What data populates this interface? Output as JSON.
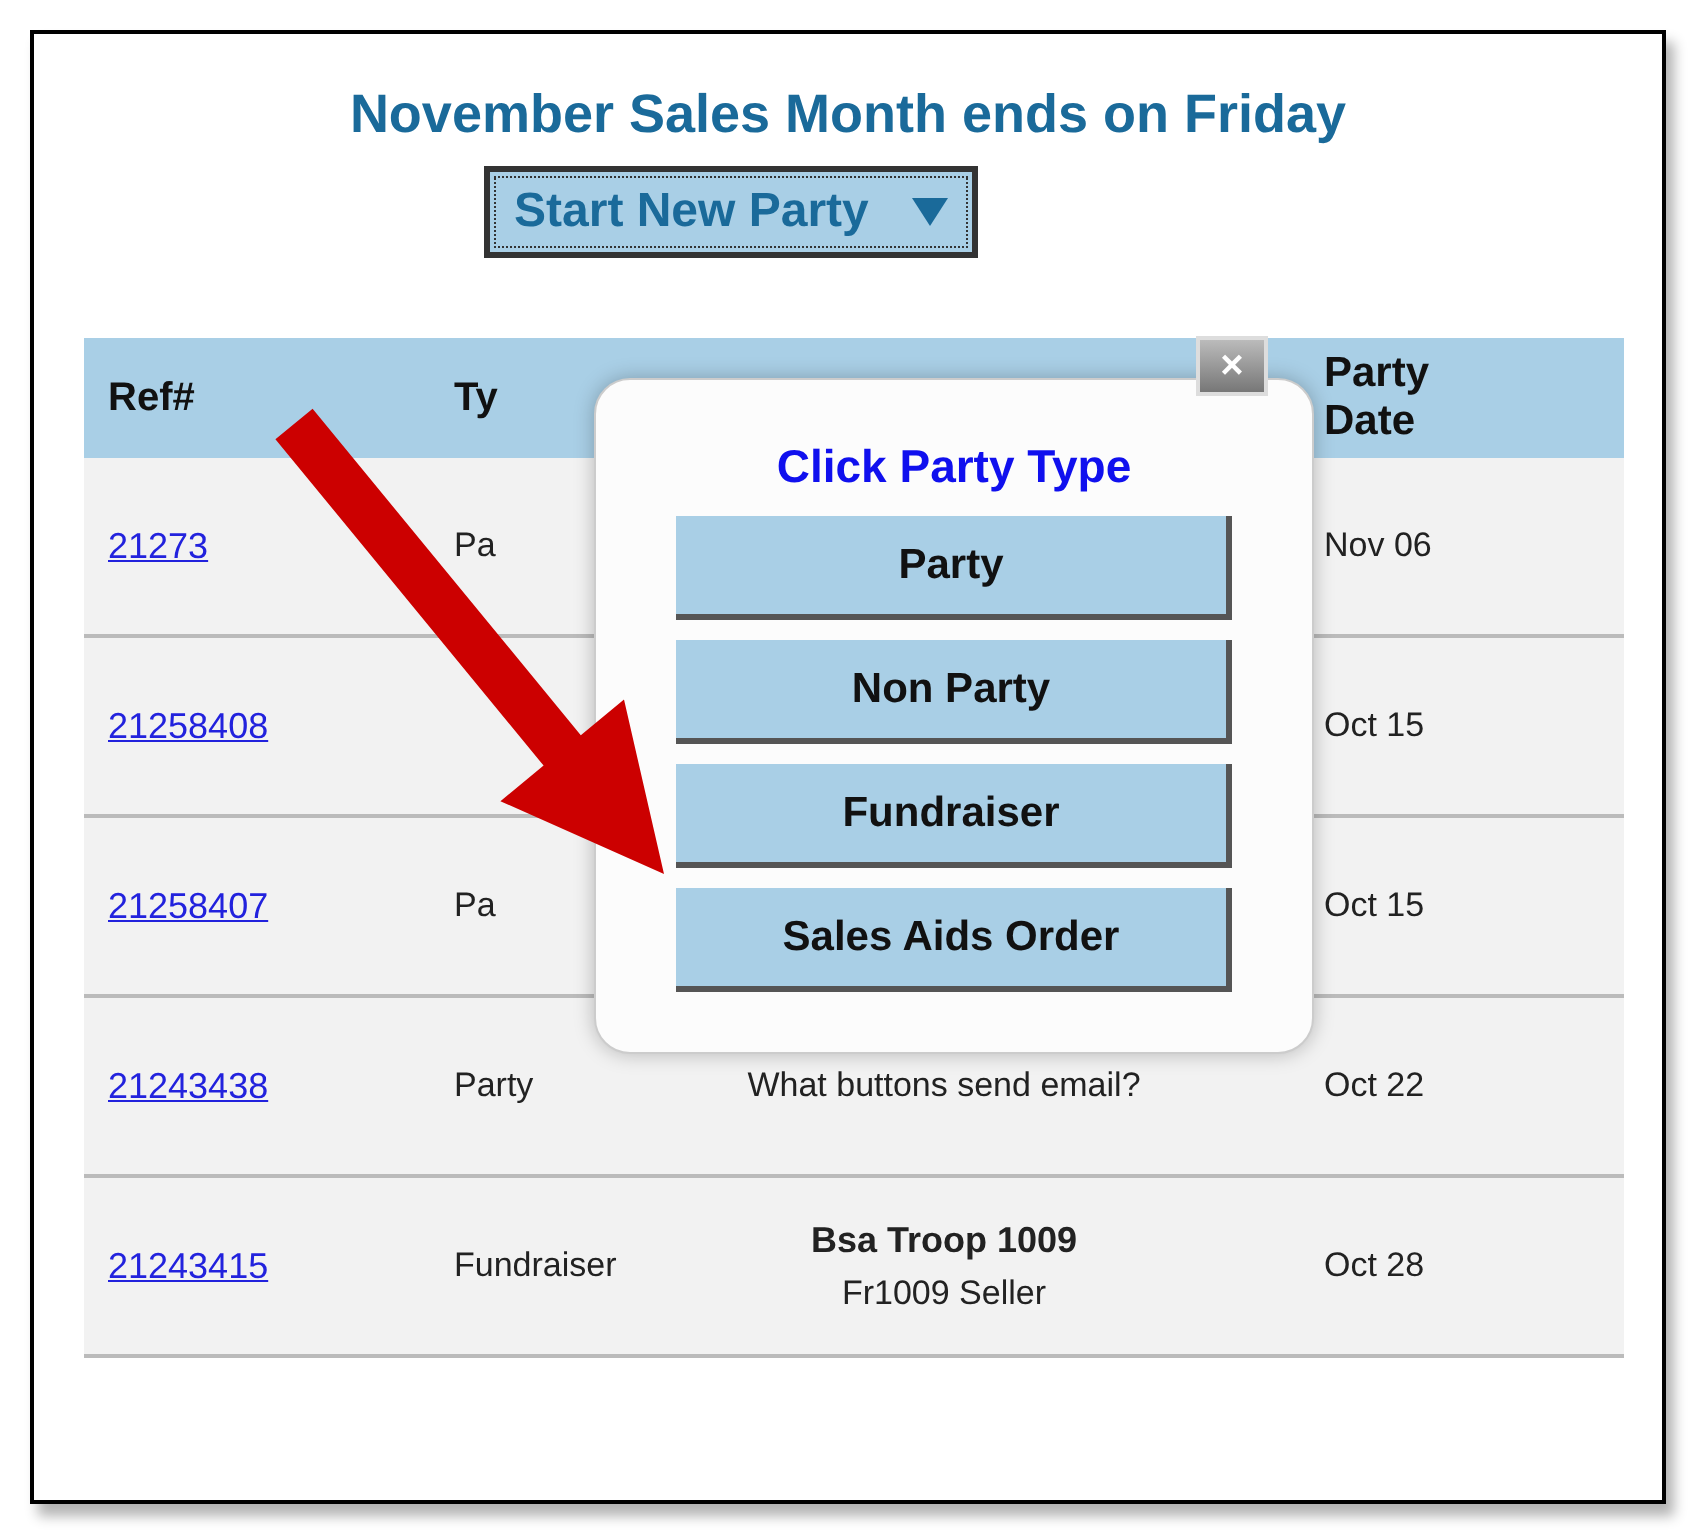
{
  "title": "November Sales Month ends on Friday",
  "new_party_button": {
    "label": "Start New Party"
  },
  "table": {
    "columns": [
      "Ref#",
      "Ty",
      "Party Date"
    ],
    "rows": [
      {
        "ref": "21273",
        "type": "Pa",
        "date": "Nov 06"
      },
      {
        "ref": "21258408",
        "date": "Oct 15"
      },
      {
        "ref": "21258407",
        "type": "Pa",
        "date": "Oct 15"
      },
      {
        "ref": "21243438",
        "type": "Party",
        "description": [
          "What buttons send email?"
        ],
        "date": "Oct 22"
      },
      {
        "ref": "21243415",
        "type": "Fundraiser",
        "title": "Bsa Troop 1009",
        "description": [
          "Fr1009 Seller"
        ],
        "date": "Oct 28"
      }
    ]
  },
  "popup": {
    "close": "×",
    "heading": "Click Party Type",
    "options": [
      "Party",
      "Non Party",
      "Fundraiser",
      "Sales Aids Order"
    ]
  }
}
